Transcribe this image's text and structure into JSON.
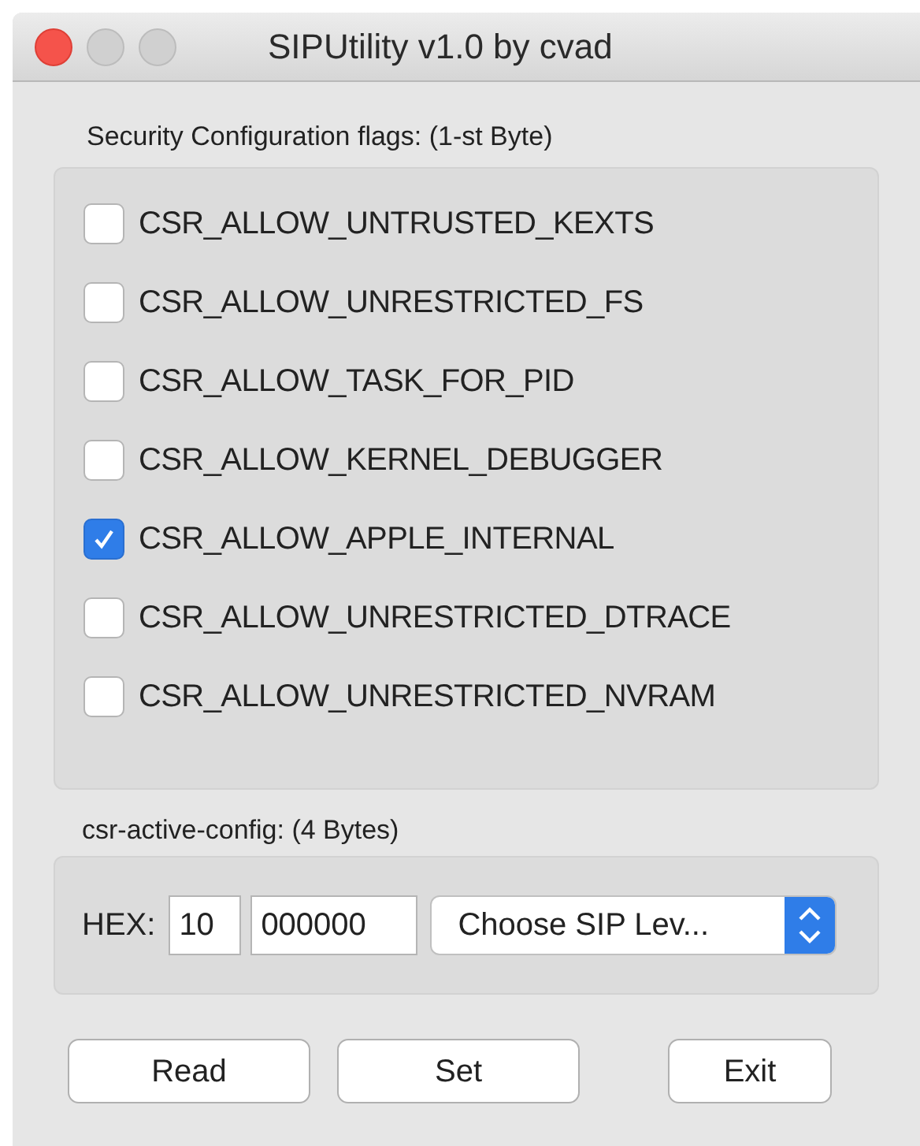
{
  "window": {
    "title": "SIPUtility v1.0 by cvad"
  },
  "flags_group": {
    "label": "Security Configuration flags: (1-st Byte)",
    "flags": [
      {
        "label": "CSR_ALLOW_UNTRUSTED_KEXTS",
        "checked": false
      },
      {
        "label": "CSR_ALLOW_UNRESTRICTED_FS",
        "checked": false
      },
      {
        "label": "CSR_ALLOW_TASK_FOR_PID",
        "checked": false
      },
      {
        "label": "CSR_ALLOW_KERNEL_DEBUGGER",
        "checked": false
      },
      {
        "label": "CSR_ALLOW_APPLE_INTERNAL",
        "checked": true
      },
      {
        "label": "CSR_ALLOW_UNRESTRICTED_DTRACE",
        "checked": false
      },
      {
        "label": "CSR_ALLOW_UNRESTRICTED_NVRAM",
        "checked": false
      }
    ]
  },
  "config_group": {
    "label": "csr-active-config: (4 Bytes)",
    "hex_label": "HEX:",
    "hex_high": "10",
    "hex_low": "000000",
    "sip_level": "Choose SIP Lev..."
  },
  "buttons": [
    "Read",
    "Set",
    "Exit"
  ]
}
